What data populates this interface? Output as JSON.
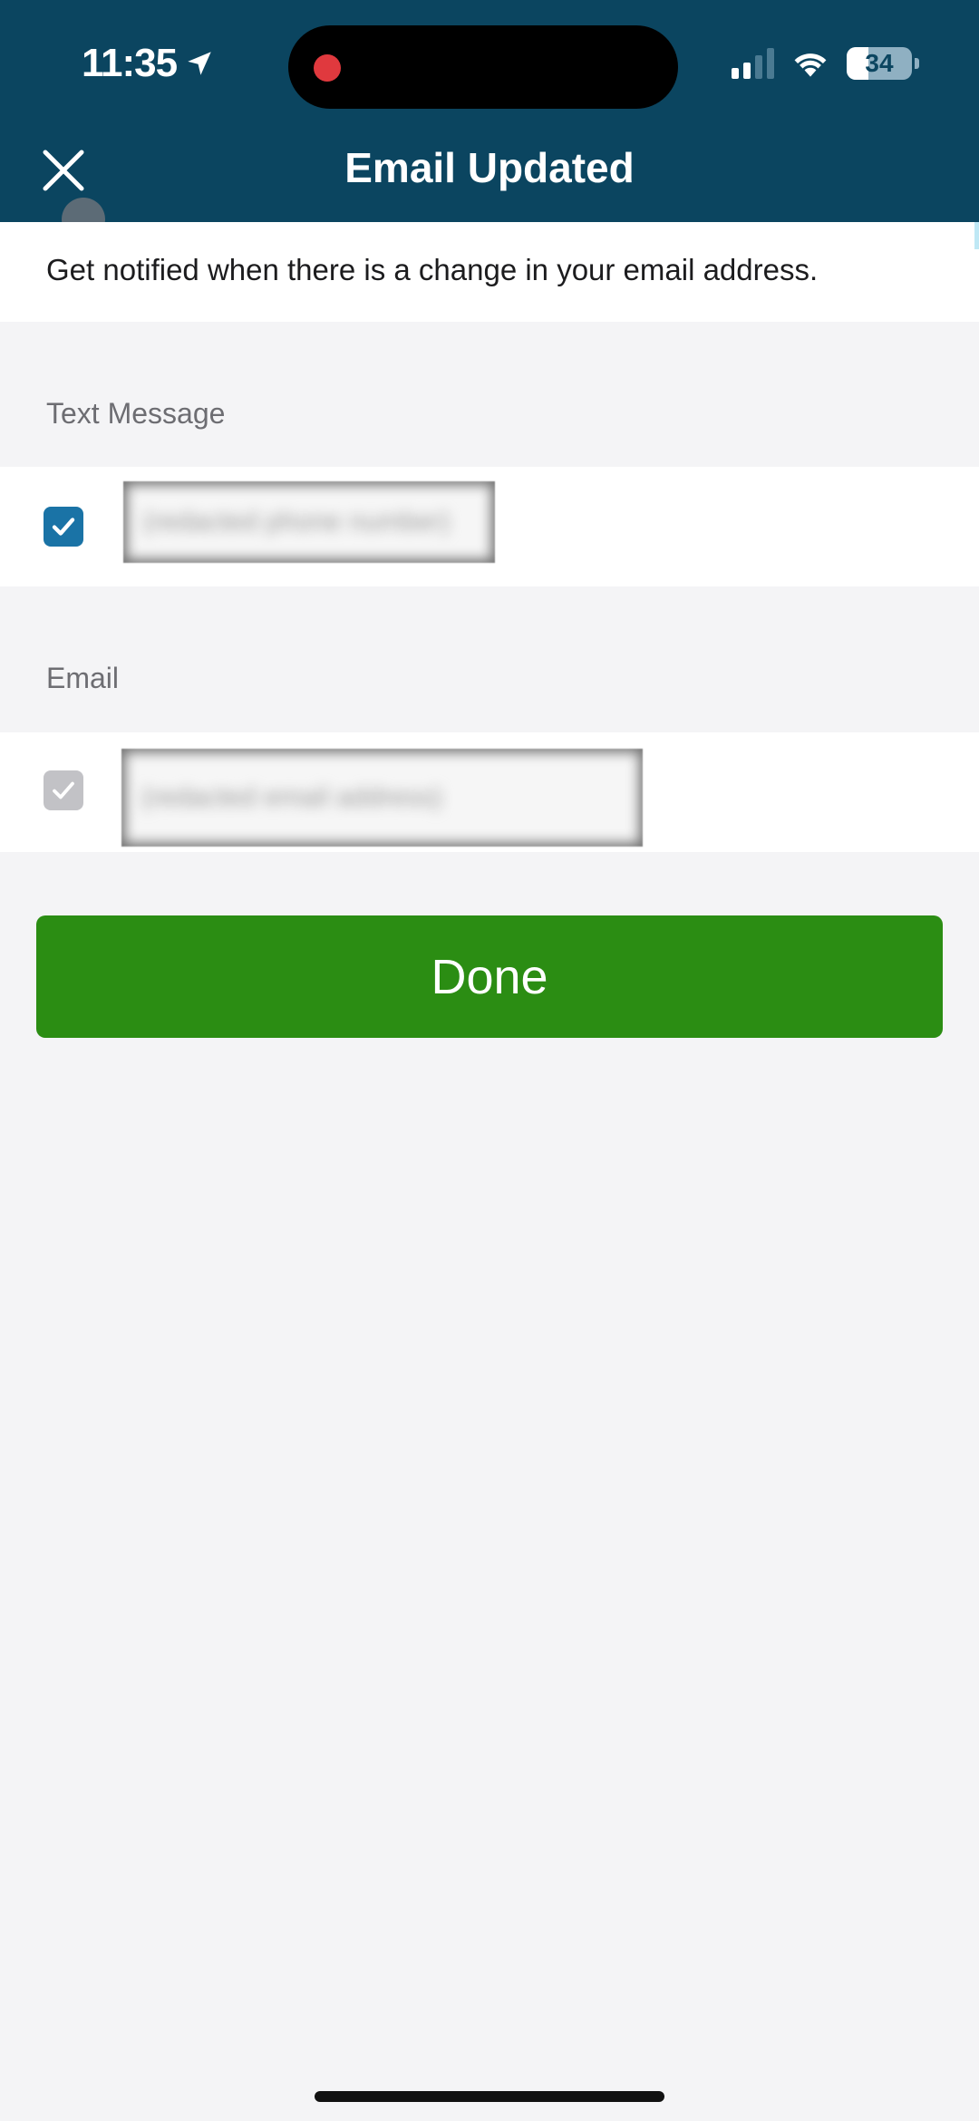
{
  "status_bar": {
    "time": "11:35",
    "location_icon": "location-arrow-icon",
    "recording_indicator": "recording-dot-icon",
    "signal_icon": "cellular-signal-icon",
    "signal_bars_active": 2,
    "signal_bars_total": 4,
    "wifi_icon": "wifi-icon",
    "battery_percent": "34"
  },
  "header": {
    "title": "Email Updated",
    "close_icon": "close-icon",
    "background_color": "#0b4560"
  },
  "intro": {
    "text": "Get notified when there is a change in your email address."
  },
  "sections": [
    {
      "label": "Text Message",
      "checked": true,
      "enabled": true,
      "value": "(redacted phone number)"
    },
    {
      "label": "Email",
      "checked": true,
      "enabled": false,
      "value": "(redacted email address)"
    }
  ],
  "actions": {
    "done_label": "Done",
    "done_color": "#2b8d13"
  },
  "colors": {
    "checkbox_active": "#1a73a6",
    "checkbox_disabled": "#c2c2c6",
    "page_background": "#f4f4f6"
  }
}
